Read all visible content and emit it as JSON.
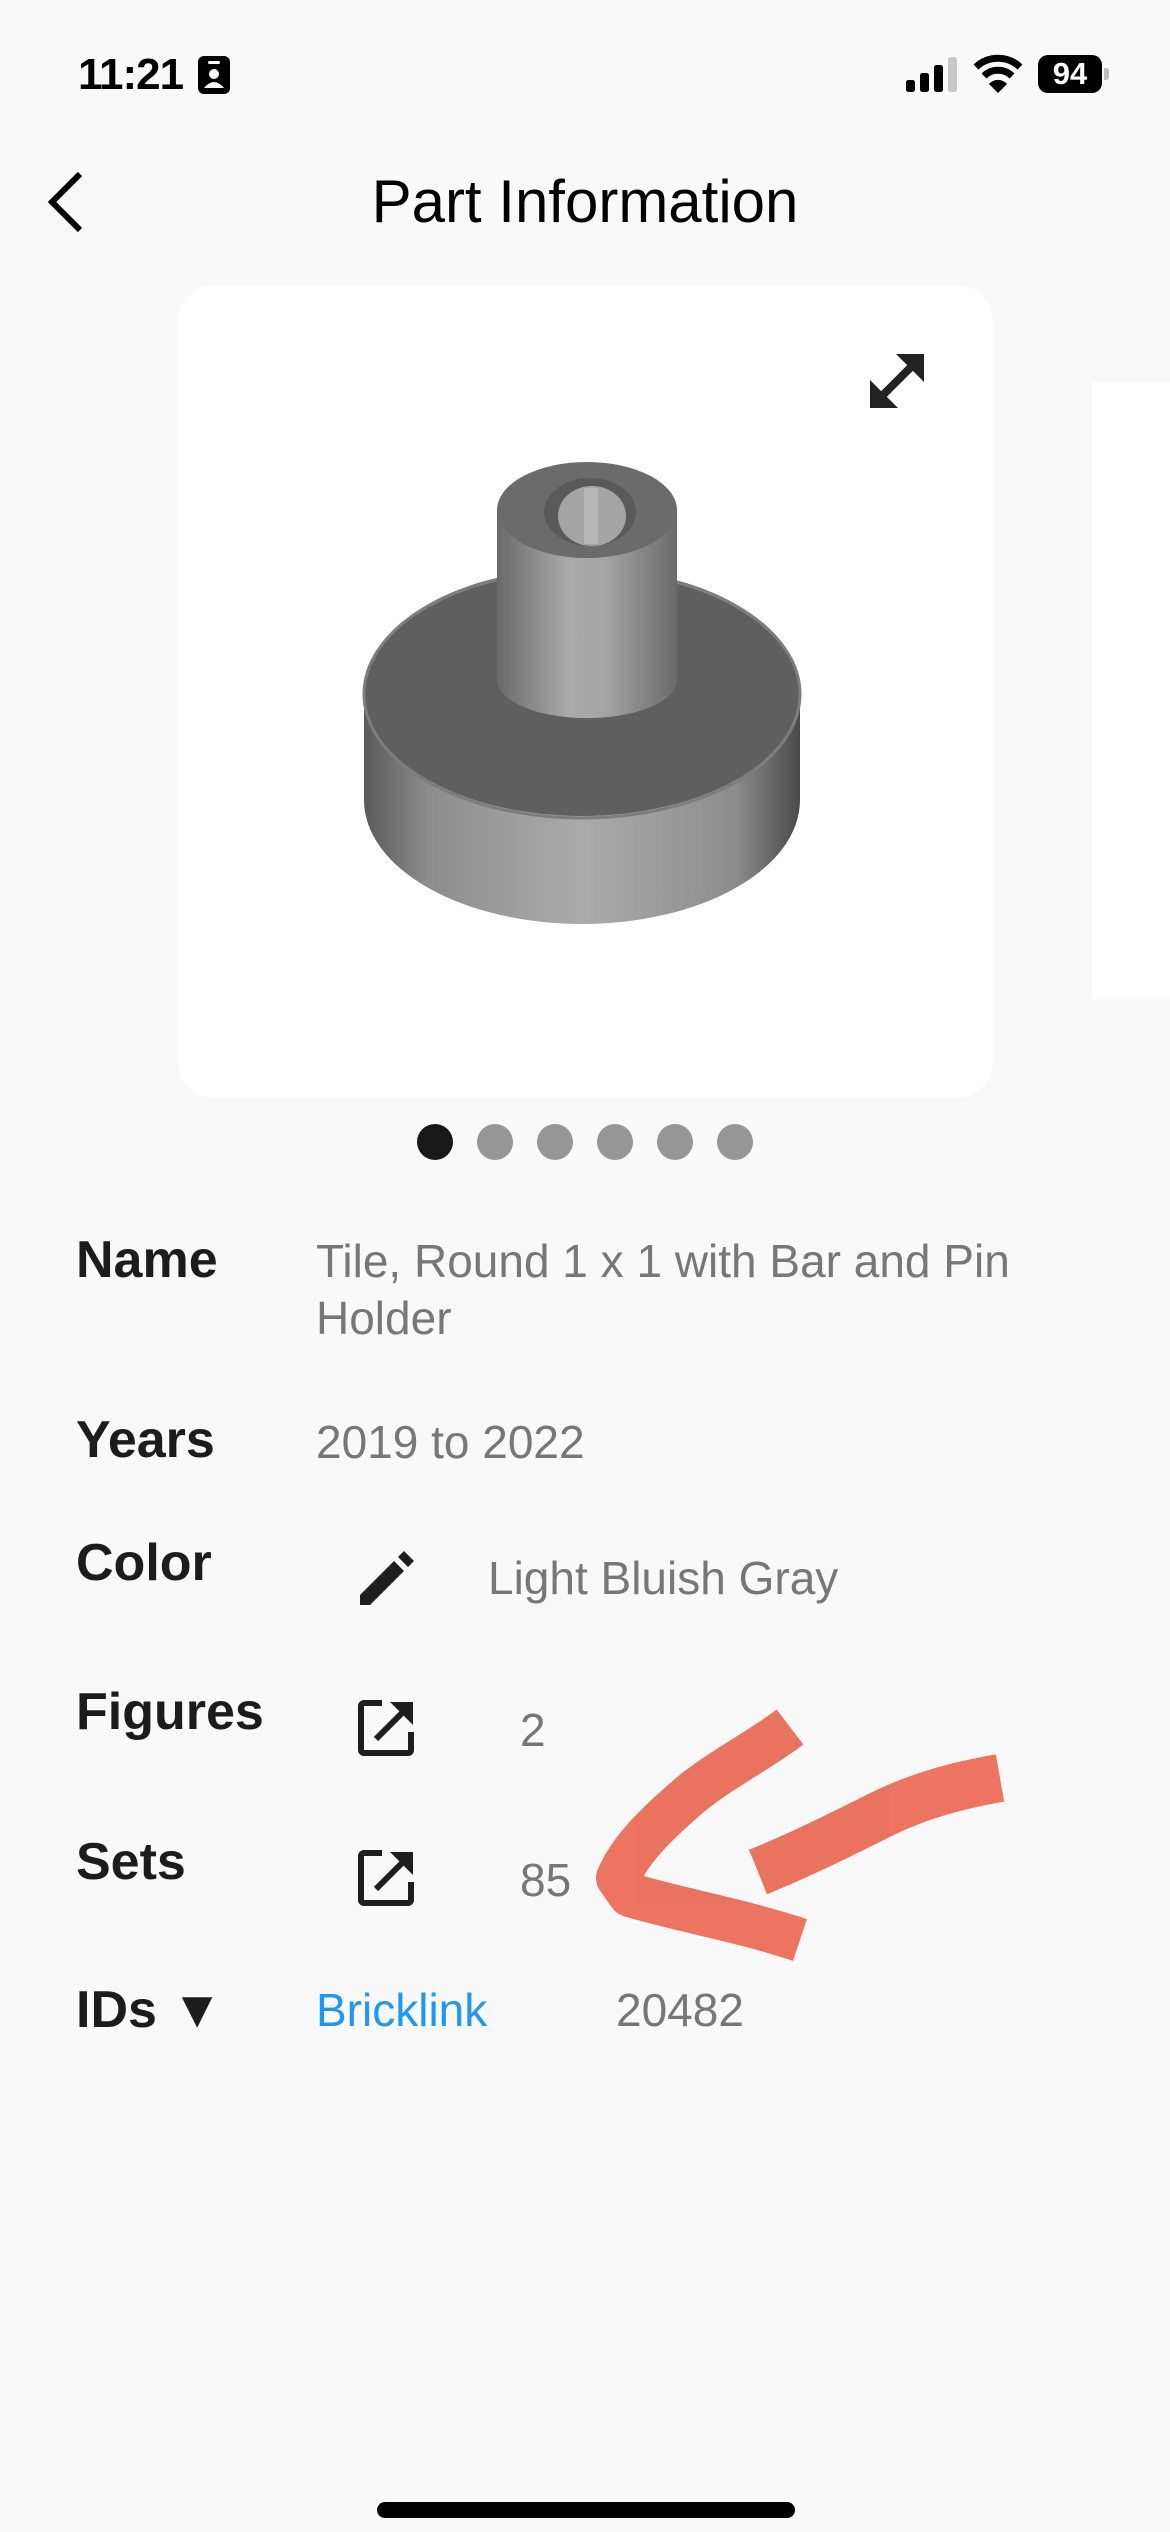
{
  "status_bar": {
    "time": "11:21",
    "badge_icon": "contact-card-icon",
    "signal_bars": 3,
    "signal_bars_max": 4,
    "wifi": "wifi-icon",
    "battery_percent": "94"
  },
  "nav": {
    "back_icon": "chevron-left-icon",
    "title": "Part Information"
  },
  "carousel": {
    "expand_icon": "expand-diagonal-icon",
    "image_alt": "Tile, Round 1 x 1 with Bar and Pin Holder — rendered part image",
    "page_count": 6,
    "active_page": 1
  },
  "details": {
    "name": {
      "label": "Name",
      "line1": "Tile, Round 1 x 1 with Bar and Pin",
      "line2": "Holder"
    },
    "years": {
      "label": "Years",
      "value": "2019 to 2022"
    },
    "color": {
      "label": "Color",
      "icon": "pencil-icon",
      "value": "Light Bluish Gray"
    },
    "figures": {
      "label": "Figures",
      "icon": "open-in-new-icon",
      "value": "2"
    },
    "sets": {
      "label": "Sets",
      "icon": "open-in-new-icon",
      "value": "85"
    },
    "ids": {
      "label": "IDs ▼",
      "source": "Bricklink",
      "value": "20482"
    }
  },
  "annotation": {
    "type": "hand-drawn arrow",
    "points_to": "Sets count",
    "color": "#E9614A"
  },
  "colors": {
    "background": "#f9f9f9",
    "link": "#2196F3",
    "value_text": "#777777",
    "dot_active": "#181818",
    "dot_inactive": "#969696"
  }
}
